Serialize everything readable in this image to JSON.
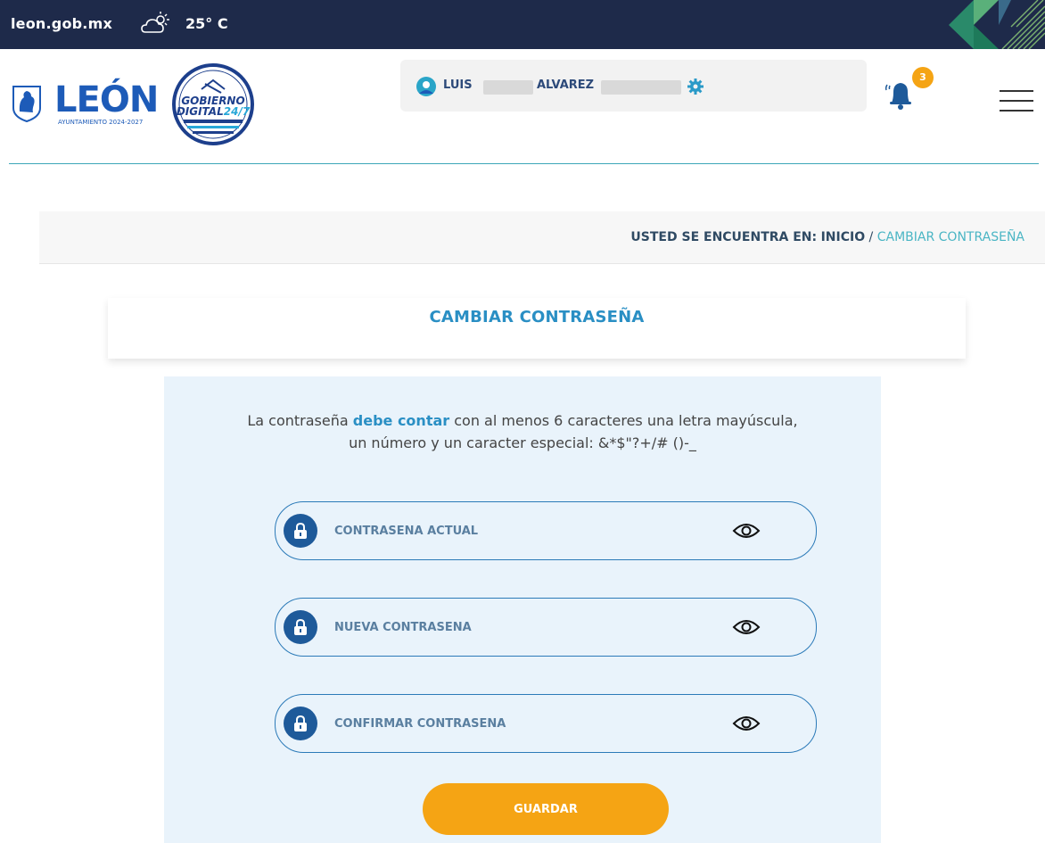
{
  "topbar": {
    "site": "leon.gob.mx",
    "weather_icon": "partly-cloudy-sun-icon",
    "temperature": "25° C"
  },
  "header": {
    "logo_leon": {
      "word": "LEÓN",
      "subtitle": "AYUNTAMIENTO 2024-2027"
    },
    "logo_gobierno": {
      "line1": "GOBIERNO",
      "line2_a": "DIGITAL",
      "line2_b": "24/7"
    },
    "user": {
      "first_name": "LUIS",
      "last_name": "ALVAREZ",
      "settings_icon": "gear-icon"
    },
    "notifications": {
      "icon": "bell-icon",
      "count": "3"
    },
    "menu_icon": "hamburger-menu-icon"
  },
  "breadcrumb": {
    "prefix": "USTED SE ENCUENTRA EN:",
    "home": "INICIO",
    "separator": " / ",
    "current": "CAMBIAR CONTRASEÑA"
  },
  "page": {
    "title": "CAMBIAR CONTRASEÑA",
    "notice_before": "La contraseña ",
    "notice_bold": "debe contar",
    "notice_after_line1": " con al menos 6 caracteres una letra mayúscula,",
    "notice_line2": "un número y un caracter especial: &*$\"?+/# ()-_"
  },
  "form": {
    "fields": [
      {
        "placeholder": "CONTRASENA ACTUAL",
        "value": "",
        "lock_icon": "lock-icon",
        "eye_icon": "eye-icon"
      },
      {
        "placeholder": "NUEVA CONTRASENA",
        "value": "",
        "lock_icon": "lock-icon",
        "eye_icon": "eye-icon"
      },
      {
        "placeholder": "CONFIRMAR CONTRASENA",
        "value": "",
        "lock_icon": "lock-icon",
        "eye_icon": "eye-icon"
      }
    ],
    "submit_label": "GUARDAR"
  },
  "colors": {
    "topbar": "#1e2a4a",
    "brand_blue": "#1d5bb8",
    "title_blue": "#2a8fc4",
    "breadcrumb_current": "#4ab5c4",
    "panel_bg": "#e9f3fb",
    "field_border": "#2b7ab8",
    "accent_orange": "#f5a414"
  }
}
